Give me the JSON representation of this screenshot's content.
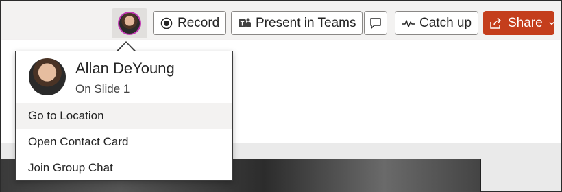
{
  "toolbar": {
    "record_label": "Record",
    "present_label": "Present in Teams",
    "catch_up_label": "Catch up",
    "share_label": "Share"
  },
  "presence_card": {
    "user_name": "Allan DeYoung",
    "status": "On Slide 1",
    "menu_items": [
      {
        "label": "Go to Location"
      },
      {
        "label": "Open Contact Card"
      },
      {
        "label": "Join Group Chat"
      }
    ]
  },
  "colors": {
    "share_bg": "#c43e1c",
    "avatar_ring": "#c239b3",
    "toolbar_bg": "#f3f2f1"
  },
  "icons": {
    "record": "record-icon",
    "present": "teams-icon",
    "comments": "comment-icon",
    "catch_up": "activity-icon",
    "share": "share-icon",
    "share_menu": "chevron-down-icon"
  }
}
